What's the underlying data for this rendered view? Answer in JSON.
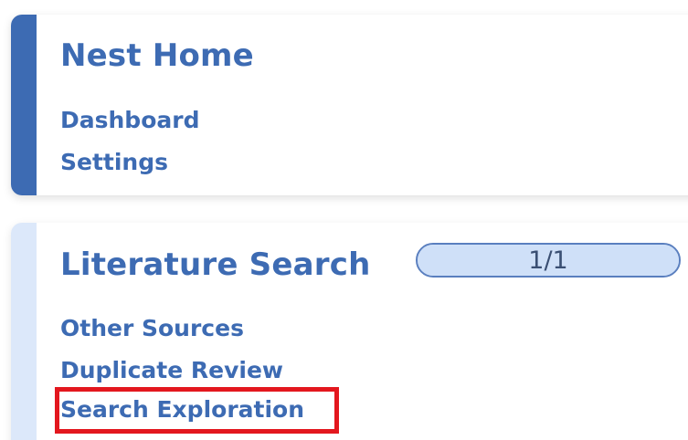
{
  "nest_home": {
    "title": "Nest Home",
    "links": [
      {
        "label": "Dashboard"
      },
      {
        "label": "Settings"
      }
    ]
  },
  "literature_search": {
    "title": "Literature Search",
    "progress": {
      "text": "1/1",
      "fraction": 1.0
    },
    "links": [
      {
        "label": "Other Sources"
      },
      {
        "label": "Duplicate Review"
      },
      {
        "label": "Search Exploration",
        "highlighted": true
      }
    ]
  },
  "colors": {
    "primary_blue": "#3d6bb3",
    "light_accent": "#dce8fa",
    "progress_fill": "#cfe0f8",
    "highlight_red": "#e3171e"
  }
}
